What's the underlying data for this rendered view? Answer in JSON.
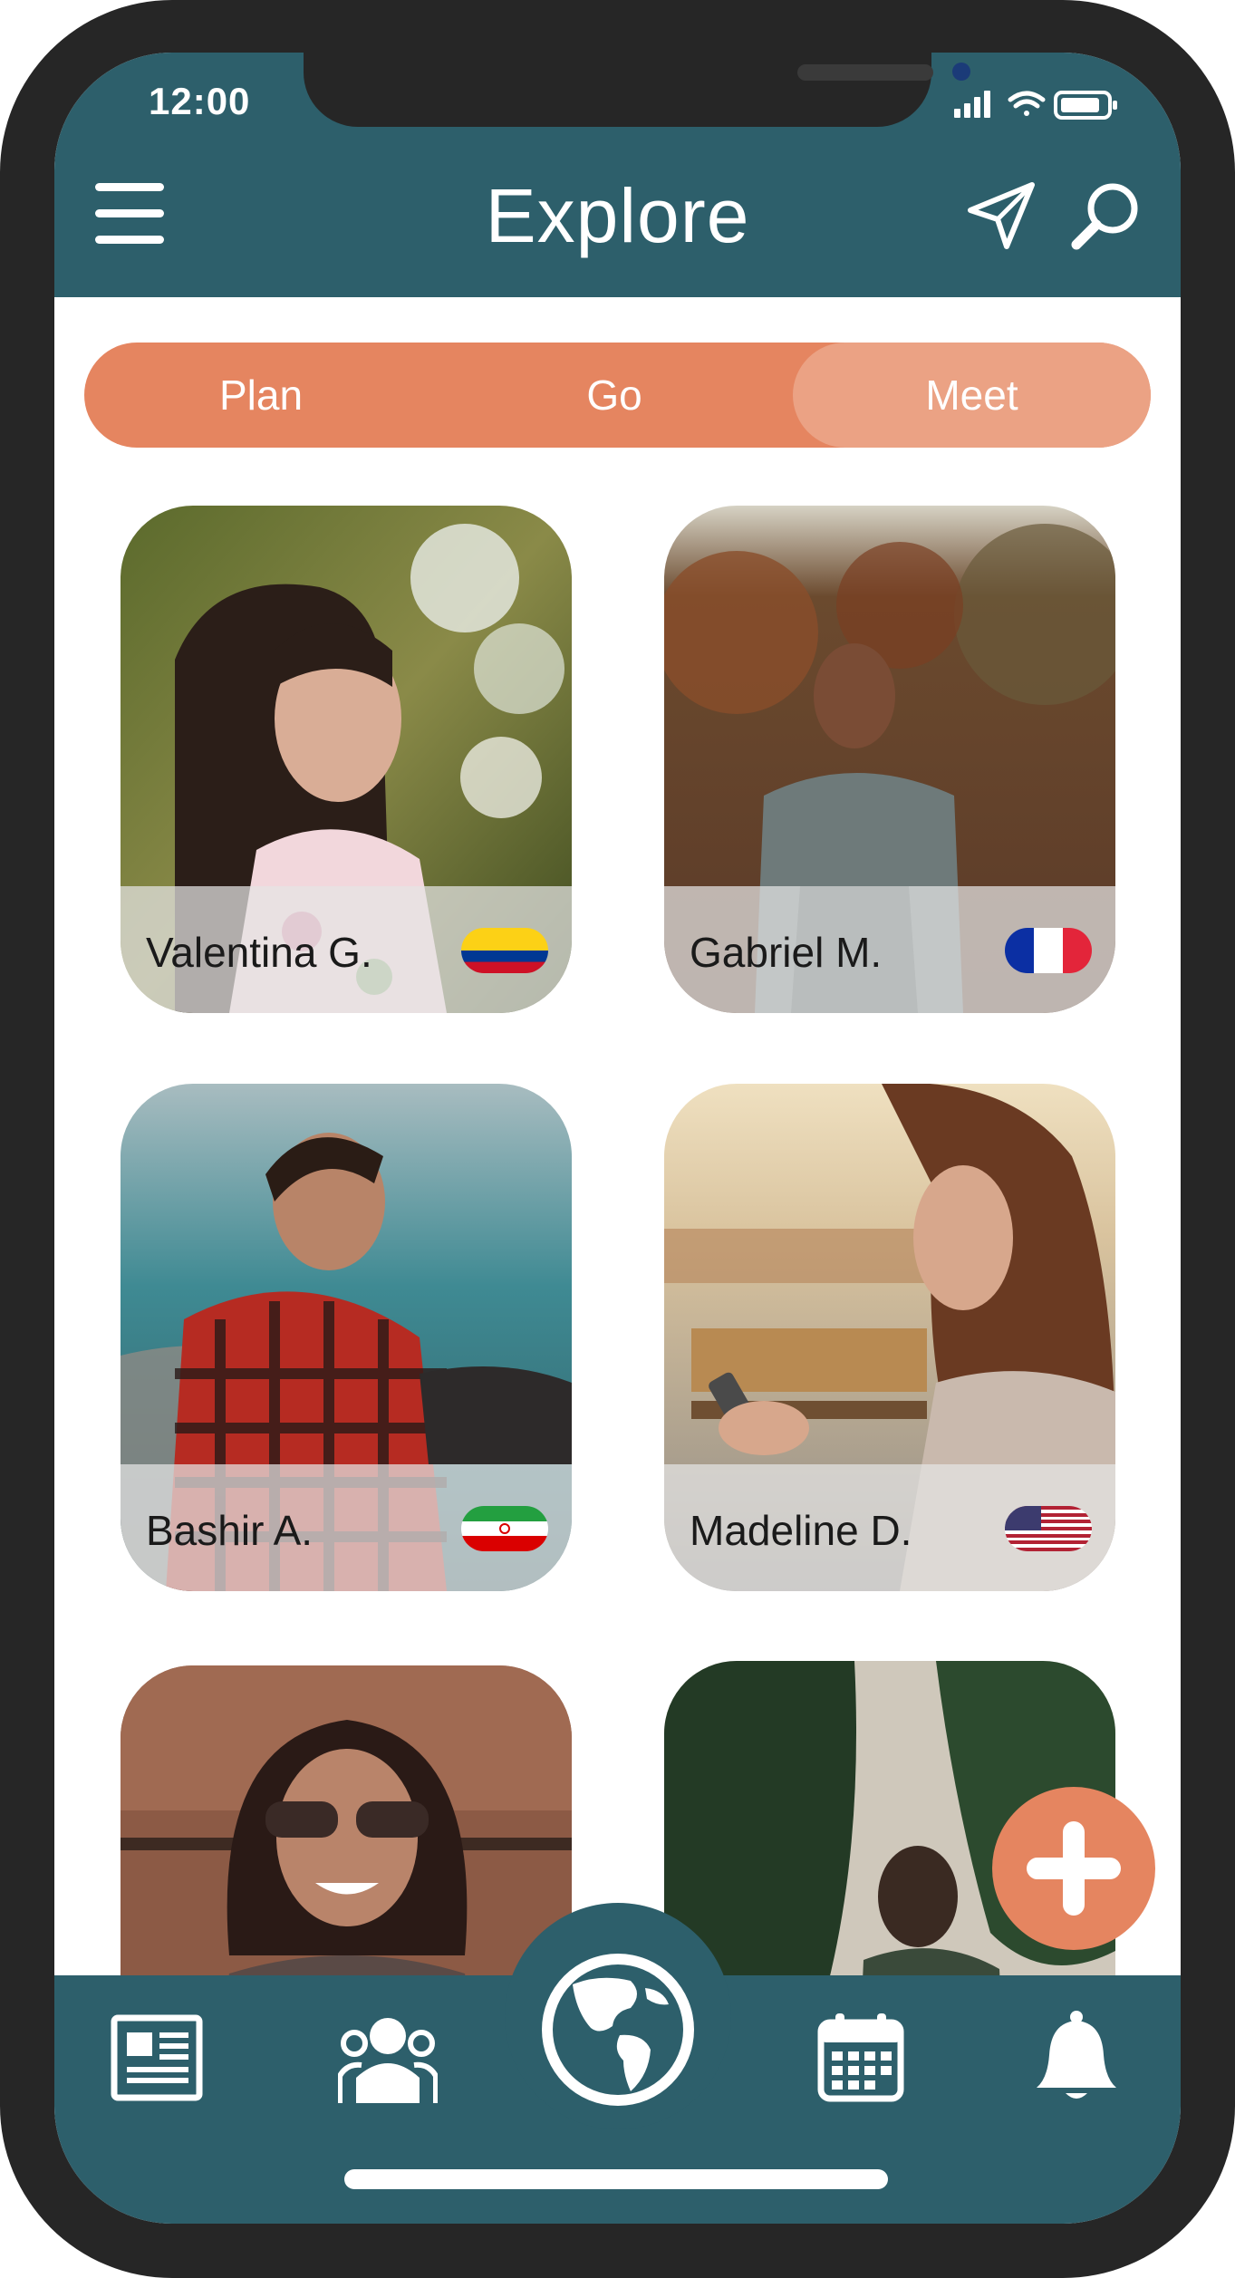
{
  "status_bar": {
    "time": "12:00"
  },
  "header": {
    "title": "Explore"
  },
  "tabs": [
    {
      "label": "Plan",
      "active": false
    },
    {
      "label": "Go",
      "active": false
    },
    {
      "label": "Meet",
      "active": true
    }
  ],
  "people": [
    {
      "name": "Valentina G.",
      "flag": "flag-colombia-icon"
    },
    {
      "name": "Gabriel M.",
      "flag": "flag-france-icon"
    },
    {
      "name": "Bashir A.",
      "flag": "flag-iran-icon"
    },
    {
      "name": "Madeline D.",
      "flag": "flag-usa-icon"
    },
    {
      "name": "",
      "flag": ""
    },
    {
      "name": "",
      "flag": ""
    }
  ],
  "bottom_nav": [
    {
      "icon": "news-icon"
    },
    {
      "icon": "people-icon"
    },
    {
      "icon": "globe-icon"
    },
    {
      "icon": "calendar-icon"
    },
    {
      "icon": "bell-icon"
    }
  ],
  "colors": {
    "primary": "#2d5f6b",
    "accent": "#e58560",
    "accent_light": "#eba284",
    "frame": "#262626"
  }
}
